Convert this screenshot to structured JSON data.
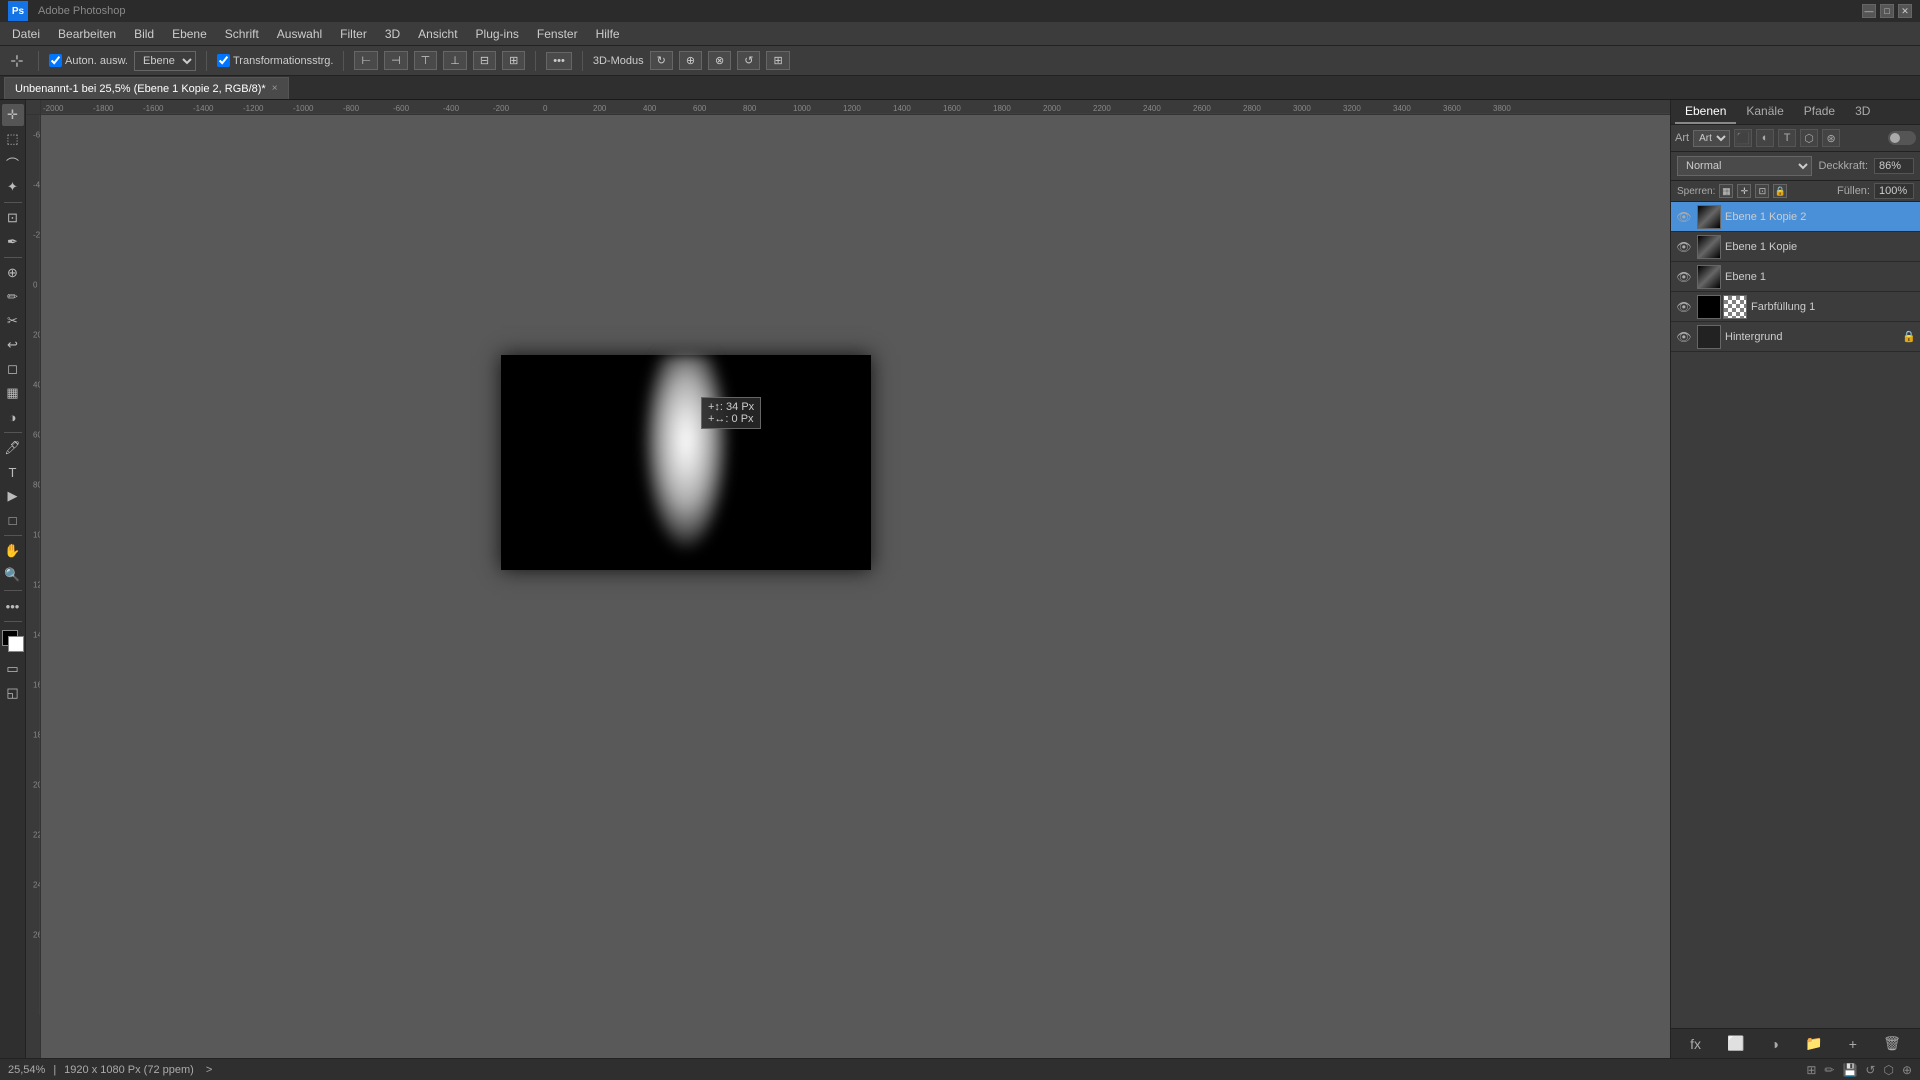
{
  "titlebar": {
    "app_name": "Adobe Photoshop",
    "window_controls": [
      "—",
      "□",
      "✕"
    ]
  },
  "menubar": {
    "items": [
      "Datei",
      "Bearbeiten",
      "Bild",
      "Ebene",
      "Schrift",
      "Auswahl",
      "Filter",
      "3D",
      "Ansicht",
      "Plug-ins",
      "Fenster",
      "Hilfe"
    ]
  },
  "optionsbar": {
    "tool_label": "Auton. ausw.",
    "layer_mode": "Ebene",
    "transform_label": "Transformationsstrg.",
    "mode_3d": "3D-Modus"
  },
  "tab": {
    "title": "Unbenannt-1 bei 25,5% (Ebene 1 Kopie 2, RGB/8)*",
    "close": "×"
  },
  "canvas": {
    "tooltip": {
      "line1": "+↕: 34 Px",
      "line2": "+↔: 0 Px"
    }
  },
  "rightpanel": {
    "tabs": [
      "Ebenen",
      "Kanäle",
      "Pfade",
      "3D"
    ],
    "active_tab": "Ebenen",
    "filter_label": "Art",
    "blend_mode": "Normal",
    "opacity_label": "Deckkraft:",
    "opacity_value": "86%",
    "fill_label": "Füllen:",
    "fill_value": "100%",
    "layers": [
      {
        "name": "Ebene 1 Kopie 2",
        "visible": true,
        "thumb": "gradient",
        "active": true
      },
      {
        "name": "Ebene 1 Kopie",
        "visible": true,
        "thumb": "gradient",
        "active": false
      },
      {
        "name": "Ebene 1",
        "visible": true,
        "thumb": "gradient",
        "active": false
      },
      {
        "name": "Farbfüllung 1",
        "visible": true,
        "thumb_left": "black",
        "thumb_right": "checker",
        "active": false
      },
      {
        "name": "Hintergrund",
        "visible": true,
        "thumb": "dark-grey",
        "locked": true,
        "active": false
      }
    ]
  },
  "statusbar": {
    "zoom": "25,54%",
    "dimensions": "1920 x 1080 Px (72 ppem)",
    "indicator": ">"
  }
}
